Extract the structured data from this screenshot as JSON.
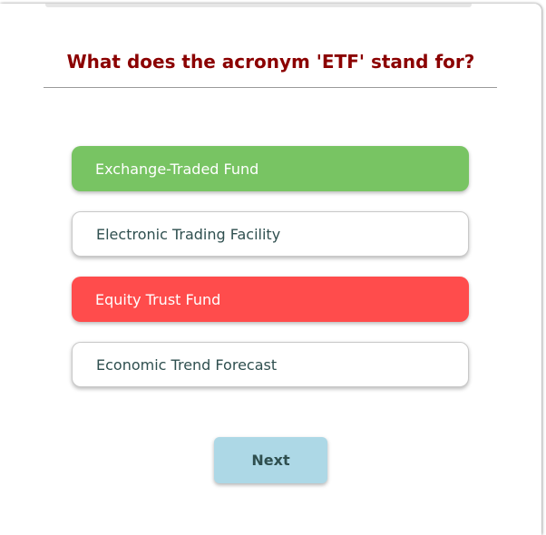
{
  "quiz": {
    "question": "What does the acronym 'ETF' stand for?",
    "options": [
      {
        "label": "Exchange-Traded Fund",
        "state": "correct",
        "color": "#78c463"
      },
      {
        "label": "Electronic Trading Facility",
        "state": "neutral",
        "color": "#ffffff"
      },
      {
        "label": "Equity Trust Fund",
        "state": "incorrect",
        "color": "#ff4c4c"
      },
      {
        "label": "Economic Trend Forecast",
        "state": "neutral",
        "color": "#ffffff"
      }
    ],
    "next_label": "Next"
  },
  "colors": {
    "question_text": "#8b0000",
    "next_button_bg": "#add8e6",
    "option_text": "#2f4f4f"
  }
}
